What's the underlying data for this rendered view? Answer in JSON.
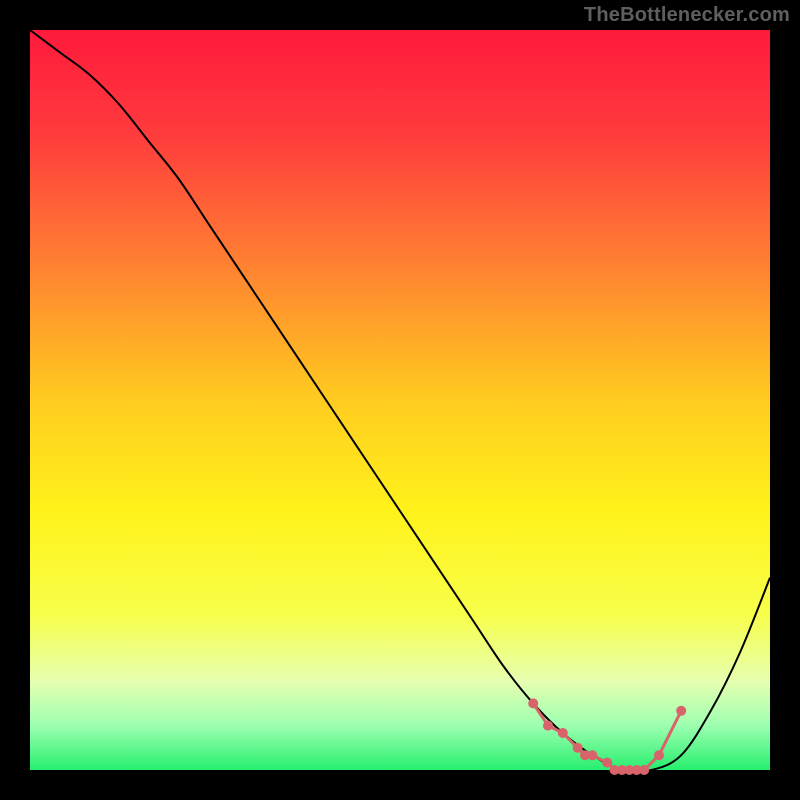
{
  "attribution": "TheBottlenecker.com",
  "chart_data": {
    "type": "line",
    "title": "",
    "xlabel": "",
    "ylabel": "",
    "xlim": [
      0,
      100
    ],
    "ylim": [
      0,
      100
    ],
    "grid": false,
    "legend": false,
    "gradient_stops": [
      {
        "pct": 0,
        "color": "#ff1a3c"
      },
      {
        "pct": 14,
        "color": "#ff3b3d"
      },
      {
        "pct": 30,
        "color": "#ff7a33"
      },
      {
        "pct": 50,
        "color": "#ffcc1f"
      },
      {
        "pct": 65,
        "color": "#fff21a"
      },
      {
        "pct": 79,
        "color": "#f7ff4a"
      },
      {
        "pct": 88,
        "color": "#e6ffb0"
      },
      {
        "pct": 94,
        "color": "#9dffb0"
      },
      {
        "pct": 100,
        "color": "#26ef6e"
      }
    ],
    "series": [
      {
        "name": "bottleneck-curve",
        "color": "#000000",
        "width": 2,
        "x": [
          0,
          4,
          8,
          12,
          16,
          20,
          24,
          28,
          32,
          36,
          40,
          44,
          48,
          52,
          56,
          60,
          64,
          68,
          72,
          76,
          80,
          84,
          88,
          92,
          96,
          100
        ],
        "y": [
          100,
          97,
          94,
          90,
          85,
          80,
          74,
          68,
          62,
          56,
          50,
          44,
          38,
          32,
          26,
          20,
          14,
          9,
          5,
          2,
          0,
          0,
          2,
          8,
          16,
          26
        ]
      }
    ],
    "highlight": {
      "name": "optimal-range-markers",
      "color": "#d9636a",
      "dot_radius": 5,
      "line_width": 3,
      "x": [
        68,
        70,
        72,
        74,
        75,
        76,
        78,
        79,
        80,
        81,
        82,
        83,
        85,
        88
      ],
      "y": [
        9,
        6,
        5,
        3,
        2,
        2,
        1,
        0,
        0,
        0,
        0,
        0,
        2,
        8
      ]
    }
  }
}
